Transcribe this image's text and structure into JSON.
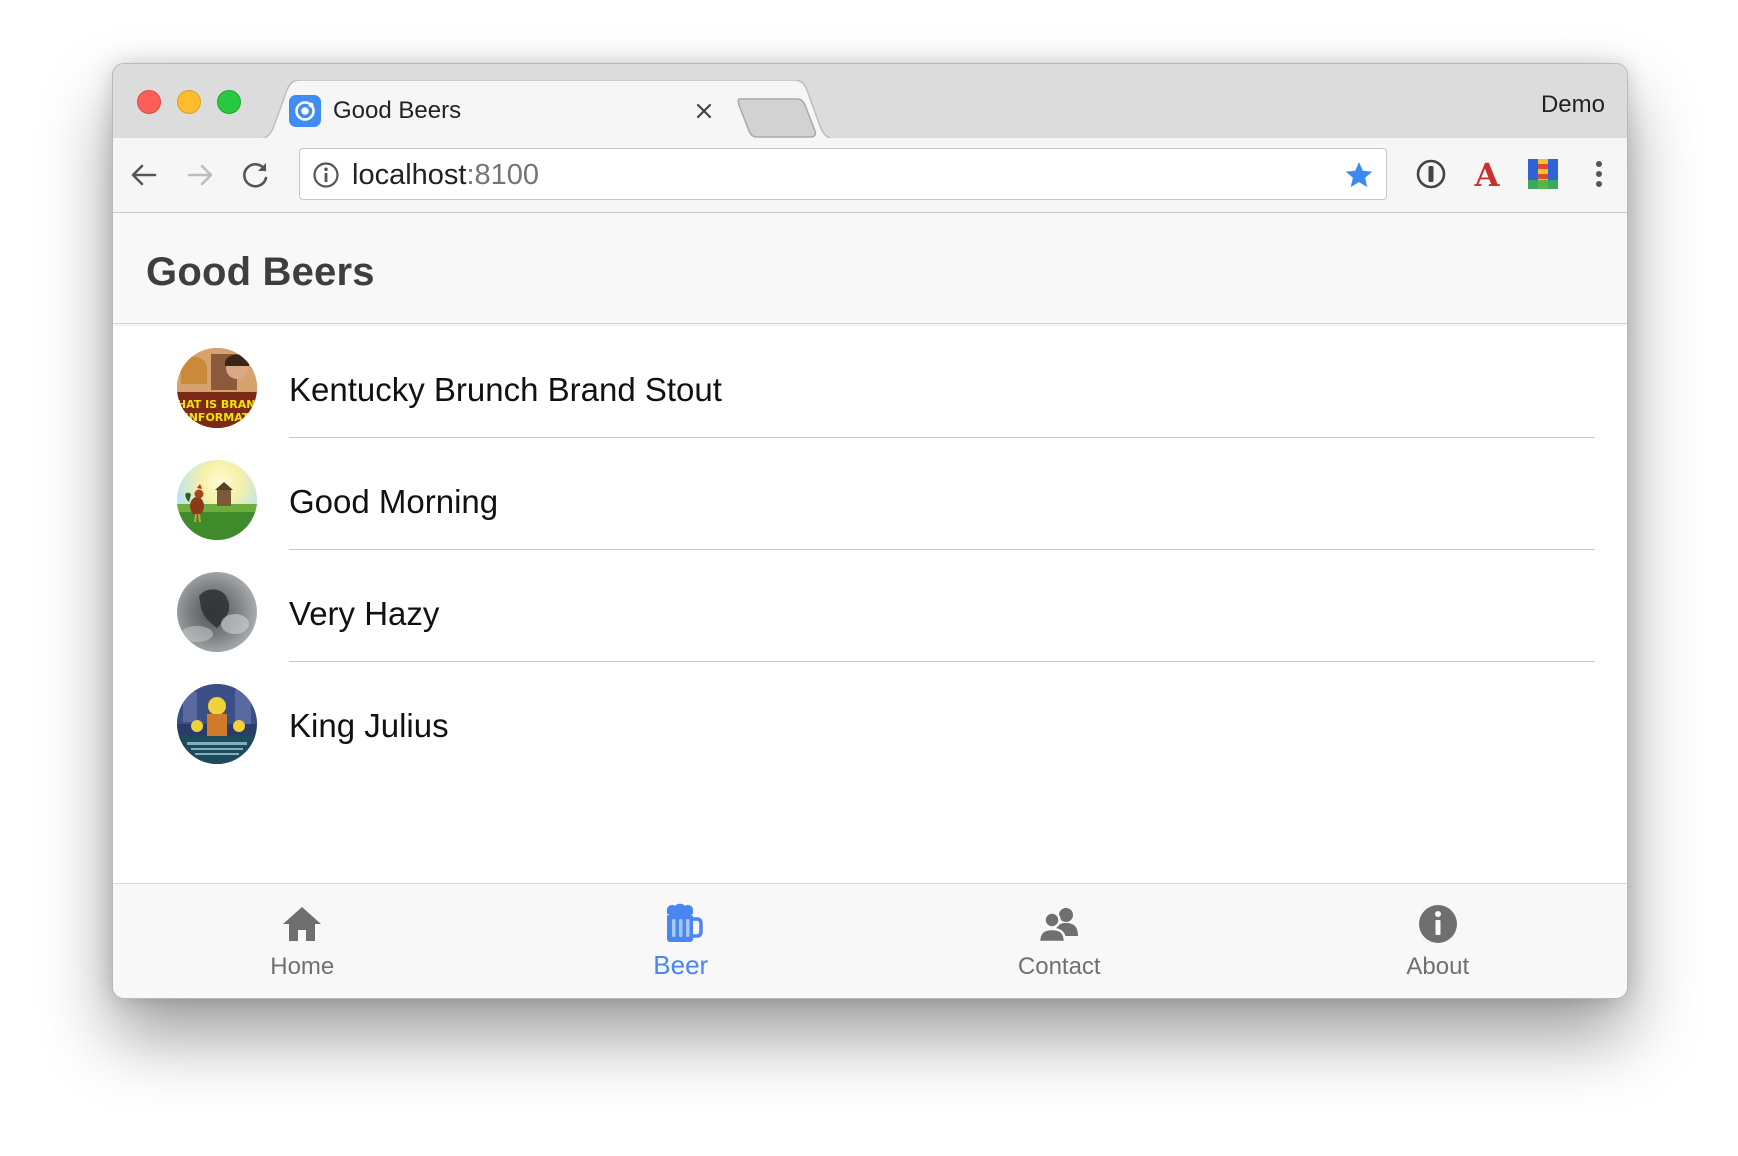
{
  "browser": {
    "tab_title": "Good Beers",
    "profile_name": "Demo",
    "url_host": "localhost",
    "url_port": ":8100"
  },
  "app": {
    "title": "Good Beers",
    "beers": [
      {
        "name": "Kentucky Brunch Brand Stout",
        "image_text": "THAT IS BRAND INFORMAT"
      },
      {
        "name": "Good Morning"
      },
      {
        "name": "Very Hazy"
      },
      {
        "name": "King Julius"
      }
    ]
  },
  "tabs": [
    {
      "label": "Home",
      "icon": "home-icon",
      "active": false
    },
    {
      "label": "Beer",
      "icon": "beer-icon",
      "active": true
    },
    {
      "label": "Contact",
      "icon": "contacts-icon",
      "active": false
    },
    {
      "label": "About",
      "icon": "info-icon",
      "active": false
    }
  ],
  "colors": {
    "accent": "#4a86f2",
    "tab_inactive": "#707070",
    "header_bg": "#f8f8f8"
  }
}
